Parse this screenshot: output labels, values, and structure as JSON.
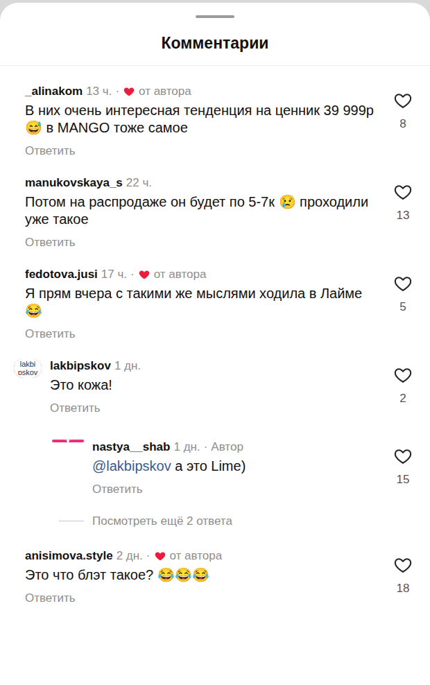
{
  "sheet": {
    "title": "Комментарии"
  },
  "comments": [
    {
      "username": "_alinakom",
      "time": "13 ч.",
      "author_liked": true,
      "author_label": "от автора",
      "text": "В них очень интересная тенденция на ценник 39 999р😅 в MANGO тоже самое",
      "reply_label": "Ответить",
      "likes": "8",
      "liked": false,
      "story_ring": false,
      "avatar_text": ""
    },
    {
      "username": "manukovskaya_s",
      "time": "22 ч.",
      "author_liked": false,
      "author_label": "",
      "text": "Потом на распродаже он будет по 5-7к 😢 проходили уже такое",
      "reply_label": "Ответить",
      "likes": "13",
      "liked": false,
      "story_ring": false,
      "avatar_text": ""
    },
    {
      "username": "fedotova.jusi",
      "time": "17 ч.",
      "author_liked": true,
      "author_label": "от автора",
      "text": "Я прям вчера с такими же мыслями ходила в Лайме 😂",
      "reply_label": "Ответить",
      "likes": "5",
      "liked": false,
      "story_ring": false,
      "avatar_text": ""
    },
    {
      "username": "lakbipskov",
      "time": "1 дн.",
      "author_liked": false,
      "author_label": "",
      "text": "Это кожа!",
      "reply_label": "Ответить",
      "likes": "2",
      "liked": false,
      "story_ring": true,
      "avatar_text": "lakbi pskov",
      "replies": [
        {
          "username": "nastya__shab",
          "time": "1 дн.",
          "badge": "Автор",
          "mention": "@lakbipskov",
          "text": " а это Lime)",
          "reply_label": "Ответить",
          "likes": "15",
          "liked": false,
          "story_ring": true
        }
      ],
      "more_replies": "Посмотреть ещё 2 ответа"
    },
    {
      "username": "anisimova.style",
      "time": "2 дн.",
      "author_liked": true,
      "author_label": "от автора",
      "text": "Это что блэт такое? 😂😂😂",
      "reply_label": "Ответить",
      "likes": "18",
      "liked": false,
      "story_ring": false,
      "avatar_text": ""
    }
  ]
}
